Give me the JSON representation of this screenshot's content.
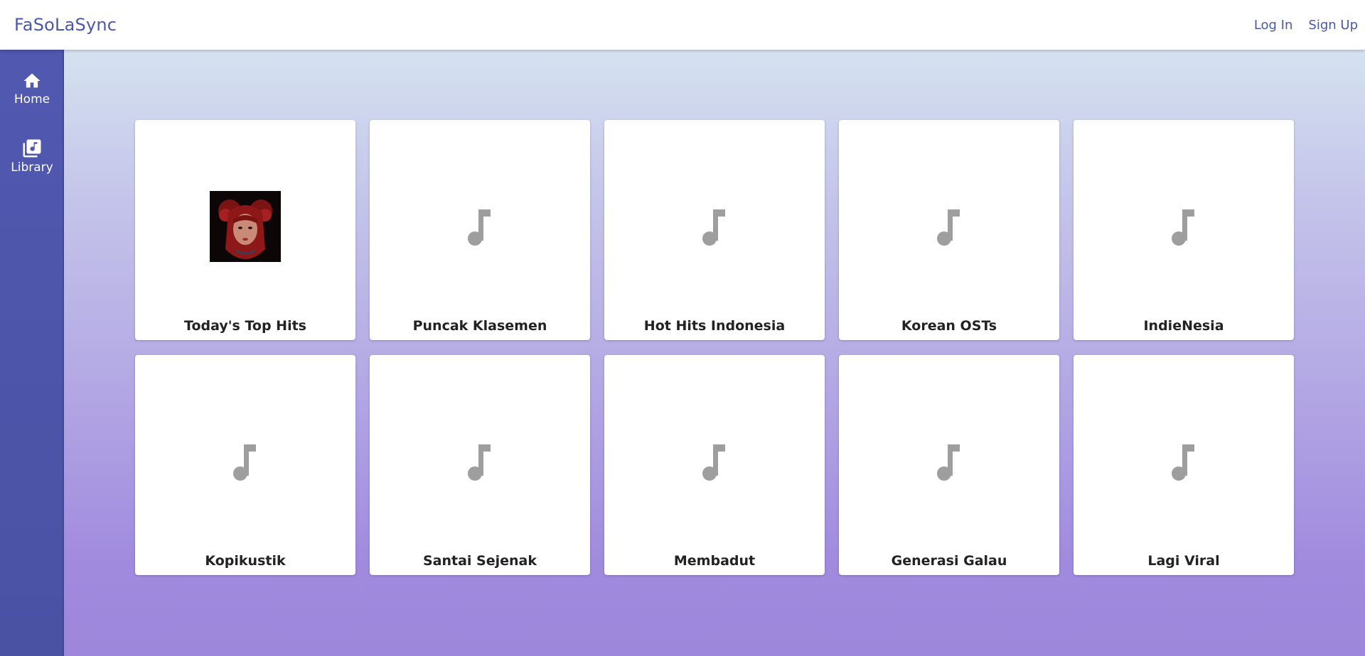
{
  "app": {
    "brand": "FaSoLaSync"
  },
  "header": {
    "login_label": "Log In",
    "signup_label": "Sign Up"
  },
  "sidebar": {
    "items": [
      {
        "label": "Home",
        "icon": "home-icon"
      },
      {
        "label": "Library",
        "icon": "library-music-icon"
      }
    ]
  },
  "playlists": [
    {
      "title": "Today's Top Hits",
      "cover": "image"
    },
    {
      "title": "Puncak Klasemen",
      "cover": "music-note-icon"
    },
    {
      "title": "Hot Hits Indonesia",
      "cover": "music-note-icon"
    },
    {
      "title": "Korean OSTs",
      "cover": "music-note-icon"
    },
    {
      "title": "IndieNesia",
      "cover": "music-note-icon"
    },
    {
      "title": "Kopikustik",
      "cover": "music-note-icon"
    },
    {
      "title": "Santai Sejenak",
      "cover": "music-note-icon"
    },
    {
      "title": "Membadut",
      "cover": "music-note-icon"
    },
    {
      "title": "Generasi Galau",
      "cover": "music-note-icon"
    },
    {
      "title": "Lagi Viral",
      "cover": "music-note-icon"
    }
  ],
  "colors": {
    "brand": "#4a58a8",
    "sidebar": "#5058b0",
    "note_icon": "#9e9e9e"
  }
}
